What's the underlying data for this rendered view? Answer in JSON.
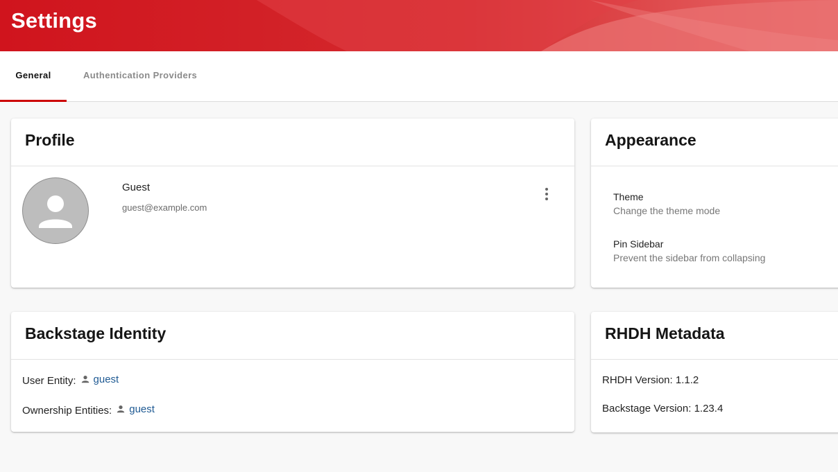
{
  "header": {
    "title": "Settings"
  },
  "tabs": [
    {
      "label": "General",
      "selected": true
    },
    {
      "label": "Authentication Providers",
      "selected": false
    }
  ],
  "profile": {
    "title": "Profile",
    "name": "Guest",
    "email": "guest@example.com",
    "avatar_icon": "person-icon",
    "menu_icon": "more-vert-icon"
  },
  "appearance": {
    "title": "Appearance",
    "settings": [
      {
        "title": "Theme",
        "description": "Change the theme mode"
      },
      {
        "title": "Pin Sidebar",
        "description": "Prevent the sidebar from collapsing"
      }
    ]
  },
  "identity": {
    "title": "Backstage Identity",
    "user_entity_label": "User Entity:",
    "user_entity_value": "guest",
    "ownership_label": "Ownership Entities:",
    "ownership_value": "guest"
  },
  "metadata": {
    "title": "RHDH Metadata",
    "rhdh_version": "RHDH Version: 1.1.2",
    "backstage_version": "Backstage Version: 1.23.4"
  },
  "colors": {
    "header_red": "#d42128",
    "tab_indicator": "#cc0000",
    "link": "#1f5a93",
    "background": "#f8f8f8"
  }
}
